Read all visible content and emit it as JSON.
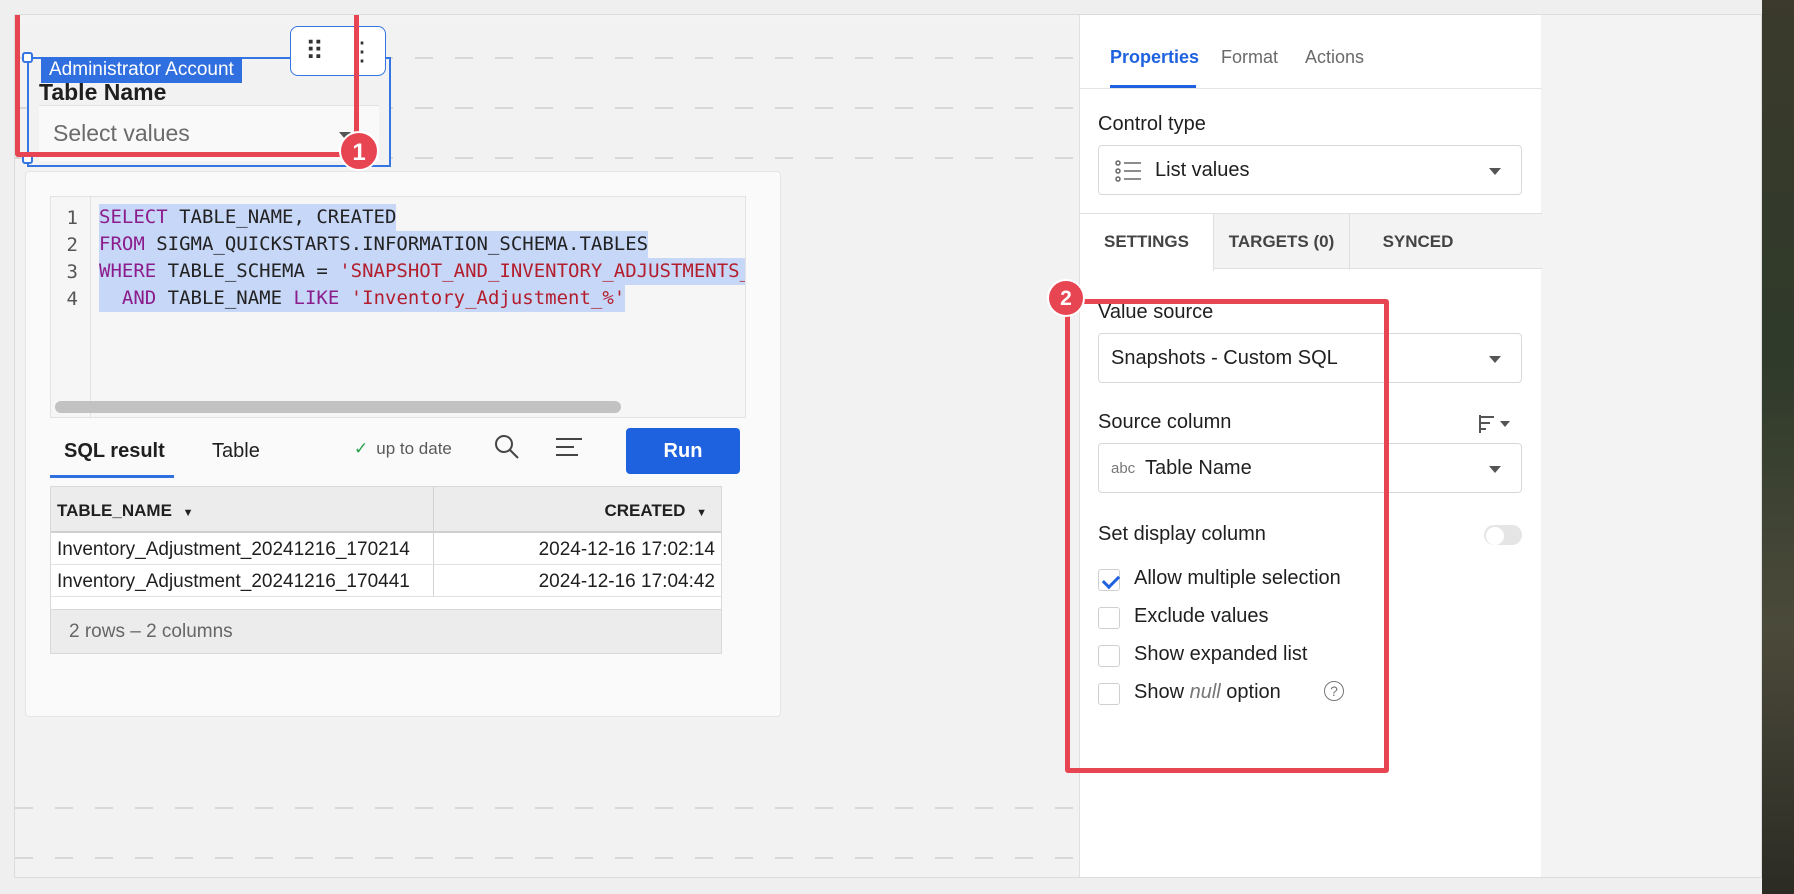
{
  "control": {
    "account_badge": "Administrator Account",
    "title": "Table Name",
    "placeholder": "Select values",
    "step_badge": "1"
  },
  "sql": {
    "line_numbers": [
      "1",
      "2",
      "3",
      "4"
    ],
    "lines": [
      {
        "kw1": "SELECT",
        "rest1": " TABLE_NAME, CREATED"
      },
      {
        "kw1": "FROM",
        "rest1": " SIGMA_QUICKSTARTS.INFORMATION_SCHEMA.TABLES"
      },
      {
        "kw1": "WHERE",
        "rest1": " TABLE_SCHEMA = ",
        "str1": "'SNAPSHOT_AND_INVENTORY_ADJUSTMENTS_"
      },
      {
        "lead": "  ",
        "kw1": "AND",
        "rest1": " TABLE_NAME ",
        "kw2": "LIKE",
        "str1": " 'Inventory_Adjustment_%'"
      }
    ]
  },
  "results": {
    "tab_sql": "SQL result",
    "tab_table": "Table",
    "status": "up to date",
    "run_label": "Run",
    "columns": [
      "TABLE_NAME",
      "CREATED"
    ],
    "rows": [
      [
        "Inventory_Adjustment_20241216_170214",
        "2024-12-16 17:02:14"
      ],
      [
        "Inventory_Adjustment_20241216_170441",
        "2024-12-16 17:04:42"
      ]
    ],
    "footer": "2 rows – 2 columns"
  },
  "panel": {
    "tabs": [
      "Properties",
      "Format",
      "Actions"
    ],
    "control_type_label": "Control type",
    "control_type_value": "List values",
    "subtabs": [
      "SETTINGS",
      "TARGETS (0)",
      "SYNCED"
    ],
    "value_source_label": "Value source",
    "value_source_value": "Snapshots - Custom SQL",
    "source_column_label": "Source column",
    "source_column_type": "abc",
    "source_column_value": "Table Name",
    "display_column_label": "Set display column",
    "checkboxes": [
      {
        "label": "Allow multiple selection",
        "checked": true
      },
      {
        "label": "Exclude values",
        "checked": false
      },
      {
        "label": "Show expanded list",
        "checked": false
      }
    ],
    "null_option": {
      "pre": "Show ",
      "em": "null",
      "post": " option"
    },
    "step_badge": "2"
  }
}
